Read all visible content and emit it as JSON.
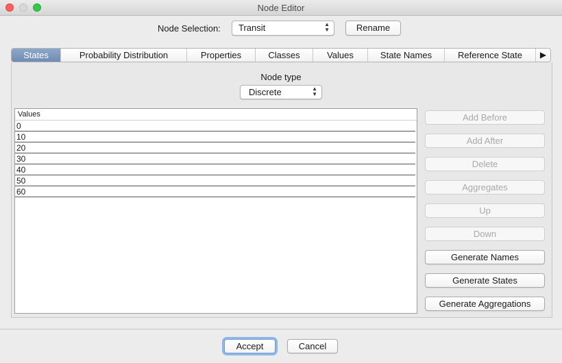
{
  "window": {
    "title": "Node Editor"
  },
  "node_selection": {
    "label": "Node Selection:",
    "value": "Transit",
    "rename_label": "Rename"
  },
  "tabs": [
    {
      "label": "States",
      "active": true
    },
    {
      "label": "Probability Distribution"
    },
    {
      "label": "Properties"
    },
    {
      "label": "Classes"
    },
    {
      "label": "Values"
    },
    {
      "label": "State Names"
    },
    {
      "label": "Reference State"
    },
    {
      "label": "▶"
    }
  ],
  "node_type": {
    "label": "Node type",
    "value": "Discrete"
  },
  "states_table": {
    "header": "Values",
    "rows": [
      "0",
      "10",
      "20",
      "30",
      "40",
      "50",
      "60"
    ]
  },
  "side_buttons": [
    {
      "label": "Add Before",
      "enabled": false
    },
    {
      "label": "Add After",
      "enabled": false
    },
    {
      "label": "Delete",
      "enabled": false
    },
    {
      "label": "Aggregates",
      "enabled": false
    },
    {
      "label": "Up",
      "enabled": false
    },
    {
      "label": "Down",
      "enabled": false
    },
    {
      "label": "Generate Names",
      "enabled": true
    },
    {
      "label": "Generate States",
      "enabled": true
    },
    {
      "label": "Generate Aggregations",
      "enabled": true
    }
  ],
  "footer": {
    "accept_label": "Accept",
    "cancel_label": "Cancel"
  },
  "colors": {
    "active_tab": "#7a96bd",
    "close": "#fc605c",
    "maximize": "#34c84a"
  }
}
